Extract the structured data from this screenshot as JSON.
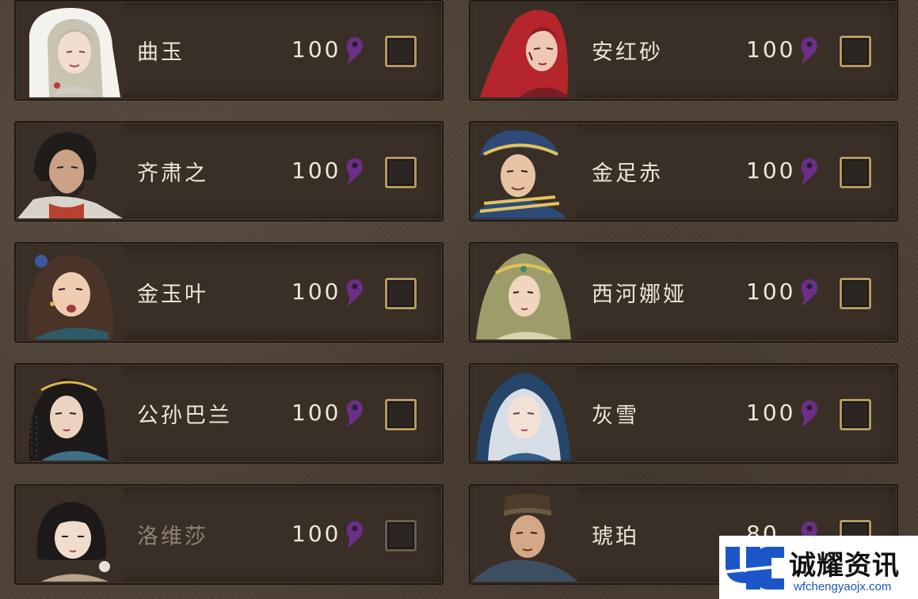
{
  "characters": [
    {
      "name": "曲玉",
      "cost": "100",
      "dim": false
    },
    {
      "name": "安红砂",
      "cost": "100",
      "dim": false
    },
    {
      "name": "齐肃之",
      "cost": "100",
      "dim": false
    },
    {
      "name": "金足赤",
      "cost": "100",
      "dim": false
    },
    {
      "name": "金玉叶",
      "cost": "100",
      "dim": false
    },
    {
      "name": "西河娜娅",
      "cost": "100",
      "dim": false
    },
    {
      "name": "公孙巴兰",
      "cost": "100",
      "dim": false
    },
    {
      "name": "灰雪",
      "cost": "100",
      "dim": false
    },
    {
      "name": "洛维莎",
      "cost": "100",
      "dim": true
    },
    {
      "name": "琥珀",
      "cost": "80",
      "dim": false
    }
  ],
  "currency_icon": "yin-magatama-icon",
  "watermark": {
    "title": "诚耀资讯",
    "url": "wfchengyaojx.com"
  },
  "colors": {
    "card_bg": "#3a2f27",
    "text": "#efe6d6",
    "checkbox_border": "#b39a63",
    "currency": "#6b2f86"
  }
}
